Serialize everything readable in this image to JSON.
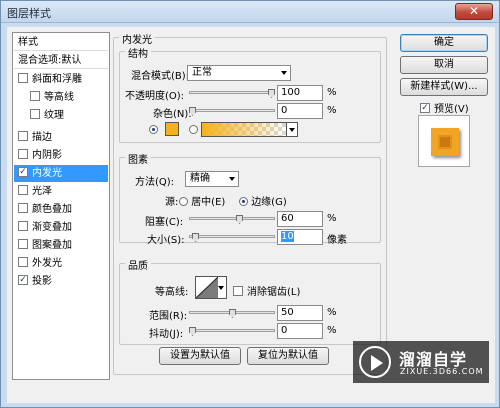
{
  "window": {
    "title": "图层样式",
    "close_label": "✕"
  },
  "sidebar": {
    "items": [
      {
        "label": "样式",
        "checkbox": false,
        "checked": false,
        "selected": false,
        "header": true
      },
      {
        "label": "混合选项:默认",
        "checkbox": false,
        "checked": false,
        "selected": false,
        "header": true
      },
      {
        "label": "斜面和浮雕",
        "checkbox": true,
        "checked": false,
        "selected": false
      },
      {
        "label": "等高线",
        "checkbox": true,
        "checked": false,
        "selected": false
      },
      {
        "label": "纹理",
        "checkbox": true,
        "checked": false,
        "selected": false
      },
      {
        "label": "描边",
        "checkbox": true,
        "checked": false,
        "selected": false
      },
      {
        "label": "内阴影",
        "checkbox": true,
        "checked": false,
        "selected": false
      },
      {
        "label": "内发光",
        "checkbox": true,
        "checked": true,
        "selected": true
      },
      {
        "label": "光泽",
        "checkbox": true,
        "checked": false,
        "selected": false
      },
      {
        "label": "颜色叠加",
        "checkbox": true,
        "checked": false,
        "selected": false
      },
      {
        "label": "渐变叠加",
        "checkbox": true,
        "checked": false,
        "selected": false
      },
      {
        "label": "图案叠加",
        "checkbox": true,
        "checked": false,
        "selected": false
      },
      {
        "label": "外发光",
        "checkbox": true,
        "checked": false,
        "selected": false
      },
      {
        "label": "投影",
        "checkbox": true,
        "checked": true,
        "selected": false
      }
    ]
  },
  "main": {
    "section_title": "内发光",
    "structure": {
      "legend": "结构",
      "blend_mode_label": "混合模式(B):",
      "blend_mode_value": "正常",
      "opacity_label": "不透明度(O):",
      "opacity_value": "100",
      "opacity_level": 1.0,
      "noise_label": "杂色(N):",
      "noise_value": "0",
      "noise_level": 0.0,
      "percent": "%",
      "glow_color": "#f5b21a"
    },
    "elements": {
      "legend": "图素",
      "technique_label": "方法(Q):",
      "technique_value": "精确",
      "source_label": "源:",
      "source_center": "居中(E)",
      "source_edge": "边缘(G)",
      "source_selected": "edge",
      "choke_label": "阻塞(C):",
      "choke_value": "60",
      "choke_level": 0.6,
      "size_label": "大小(S):",
      "size_value": "10",
      "size_level": 0.04,
      "size_unit": "像素",
      "percent": "%"
    },
    "quality": {
      "legend": "品质",
      "contour_label": "等高线:",
      "antialias_label": "消除锯齿(L)",
      "antialias_checked": false,
      "range_label": "范围(R):",
      "range_value": "50",
      "range_level": 0.5,
      "jitter_label": "抖动(J):",
      "jitter_value": "0",
      "jitter_level": 0.0,
      "percent": "%"
    },
    "make_default_label": "设置为默认值",
    "reset_default_label": "复位为默认值"
  },
  "right": {
    "ok_label": "确定",
    "cancel_label": "取消",
    "new_style_label": "新建样式(W)...",
    "preview_label": "预览(V)",
    "preview_checked": true
  },
  "watermark": {
    "title": "溜溜自学",
    "subtitle": "ZIXUE.3D66.COM"
  }
}
